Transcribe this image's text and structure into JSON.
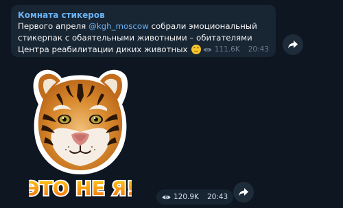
{
  "post": {
    "channel_name": "Комната стикеров",
    "text_before_mention": "Первого апреля ",
    "mention": "@kgh_moscow",
    "text_after_mention": " собрали эмоциональный стикерпак с обаятельными животными – обитателями Центра реабилитации диких животных ",
    "emoji_icon": "smiling-face-icon",
    "views": "111.6K",
    "time": "20:43"
  },
  "sticker": {
    "caption": "ЭТО НЕ Я!",
    "views": "120.9K",
    "time": "20:43"
  },
  "colors": {
    "background": "#0e1621",
    "bubble": "#182533",
    "accent": "#6ab3f3",
    "meta_text": "#6d7f8f"
  }
}
